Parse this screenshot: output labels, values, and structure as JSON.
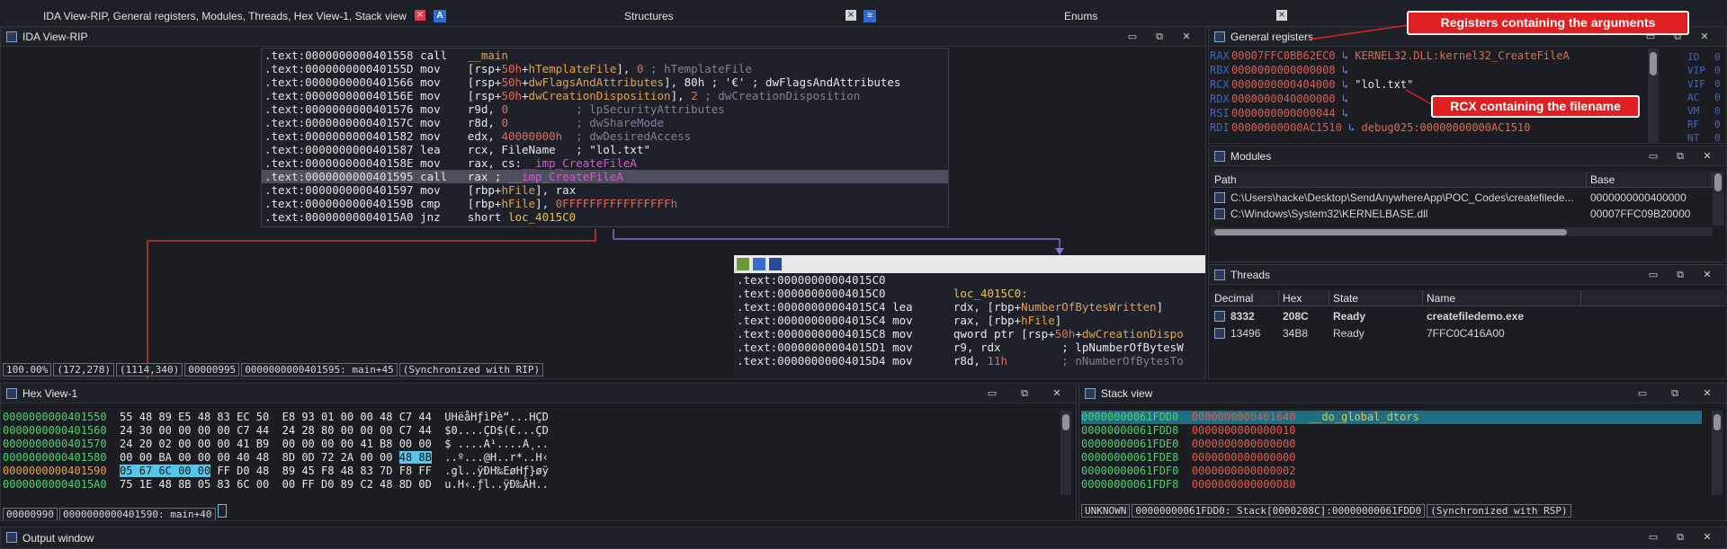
{
  "tabs": [
    {
      "label": "IDA View-RIP, General registers, Modules, Threads, Hex View-1, Stack view",
      "active": true
    },
    {
      "label": "Structures",
      "active": false
    },
    {
      "label": "Enums",
      "active": false
    }
  ],
  "ida_view": {
    "title": "IDA View-RIP",
    "main_block": [
      {
        "sec": ".text:",
        "addr": "0000000000401558",
        "mn": "call",
        "parts": [
          {
            "t": "__main",
            "c": "name"
          }
        ]
      },
      {
        "sec": ".text:",
        "addr": "000000000040155D",
        "mn": "mov",
        "parts": [
          {
            "t": "[rsp+",
            "c": "op"
          },
          {
            "t": "50h",
            "c": "imm"
          },
          {
            "t": "+",
            "c": "op"
          },
          {
            "t": "hTemplateFile",
            "c": "name"
          },
          {
            "t": "], ",
            "c": "op"
          },
          {
            "t": "0",
            "c": "imm"
          },
          {
            "t": " ; hTemplateFile",
            "c": "cm"
          }
        ]
      },
      {
        "sec": ".text:",
        "addr": "0000000000401566",
        "mn": "mov",
        "parts": [
          {
            "t": "[rsp+",
            "c": "op"
          },
          {
            "t": "50h",
            "c": "imm"
          },
          {
            "t": "+",
            "c": "op"
          },
          {
            "t": "dwFlagsAndAttributes",
            "c": "name"
          },
          {
            "t": "], 80h ; '€' ; dwFlagsAndAttributes",
            "c": "op2"
          }
        ]
      },
      {
        "sec": ".text:",
        "addr": "000000000040156E",
        "mn": "mov",
        "parts": [
          {
            "t": "[rsp+",
            "c": "op"
          },
          {
            "t": "50h",
            "c": "imm"
          },
          {
            "t": "+",
            "c": "op"
          },
          {
            "t": "dwCreationDisposition",
            "c": "name"
          },
          {
            "t": "], ",
            "c": "op"
          },
          {
            "t": "2",
            "c": "imm"
          },
          {
            "t": " ; dwCreationDisposition",
            "c": "cm"
          }
        ]
      },
      {
        "sec": ".text:",
        "addr": "0000000000401576",
        "mn": "mov",
        "parts": [
          {
            "t": "r9d, ",
            "c": "op"
          },
          {
            "t": "0",
            "c": "imm"
          },
          {
            "t": "          ; lpSecurityAttributes",
            "c": "cm"
          }
        ]
      },
      {
        "sec": ".text:",
        "addr": "000000000040157C",
        "mn": "mov",
        "parts": [
          {
            "t": "r8d, ",
            "c": "op"
          },
          {
            "t": "0",
            "c": "imm"
          },
          {
            "t": "          ; dwShareMode",
            "c": "cm"
          }
        ]
      },
      {
        "sec": ".text:",
        "addr": "0000000000401582",
        "mn": "mov",
        "parts": [
          {
            "t": "edx, ",
            "c": "op"
          },
          {
            "t": "40000000h",
            "c": "imm"
          },
          {
            "t": "  ; dwDesiredAccess",
            "c": "cm"
          }
        ]
      },
      {
        "sec": ".text:",
        "addr": "0000000000401587",
        "mn": "lea",
        "parts": [
          {
            "t": "rcx, FileName   ; \"lol.txt\"",
            "c": "op"
          }
        ]
      },
      {
        "sec": ".text:",
        "addr": "000000000040158E",
        "mn": "mov",
        "parts": [
          {
            "t": "rax, cs:",
            "c": "op"
          },
          {
            "t": "__imp_CreateFileA",
            "c": "imp"
          }
        ]
      },
      {
        "sec": ".text:",
        "addr": "0000000000401595",
        "mn": "call",
        "hl": true,
        "parts": [
          {
            "t": "rax ; ",
            "c": "op"
          },
          {
            "t": "__imp_CreateFileA",
            "c": "imp"
          }
        ]
      },
      {
        "sec": ".text:",
        "addr": "0000000000401597",
        "mn": "mov",
        "parts": [
          {
            "t": "[rbp+",
            "c": "op"
          },
          {
            "t": "hFile",
            "c": "name"
          },
          {
            "t": "], rax",
            "c": "op"
          }
        ]
      },
      {
        "sec": ".text:",
        "addr": "000000000040159B",
        "mn": "cmp",
        "parts": [
          {
            "t": "[rbp+",
            "c": "op"
          },
          {
            "t": "hFile",
            "c": "name"
          },
          {
            "t": "], ",
            "c": "op"
          },
          {
            "t": "0FFFFFFFFFFFFFFFFh",
            "c": "imm"
          }
        ]
      },
      {
        "sec": ".text:",
        "addr": "00000000004015A0",
        "mn": "jnz",
        "parts": [
          {
            "t": "short ",
            "c": "op"
          },
          {
            "t": "loc_4015C0",
            "c": "loc"
          }
        ]
      }
    ],
    "second_block": [
      {
        "sec": ".text:",
        "addr": "00000000004015C0",
        "mn": "",
        "parts": []
      },
      {
        "sec": ".text:",
        "addr": "00000000004015C0",
        "mn": "",
        "parts": [
          {
            "t": "loc_4015C0:",
            "c": "loc"
          }
        ]
      },
      {
        "sec": ".text:",
        "addr": "00000000004015C4",
        "mn": "lea",
        "parts": [
          {
            "t": "rdx, [rbp+",
            "c": "op"
          },
          {
            "t": "NumberOfBytesWritten",
            "c": "name"
          },
          {
            "t": "]",
            "c": "op"
          }
        ]
      },
      {
        "sec": ".text:",
        "addr": "00000000004015C4",
        "mn": "mov",
        "parts": [
          {
            "t": "rax, [rbp+",
            "c": "op"
          },
          {
            "t": "hFile",
            "c": "name"
          },
          {
            "t": "]",
            "c": "op"
          }
        ]
      },
      {
        "sec": ".text:",
        "addr": "00000000004015C8",
        "mn": "mov",
        "parts": [
          {
            "t": "qword ptr [rsp+",
            "c": "op"
          },
          {
            "t": "50h",
            "c": "imm"
          },
          {
            "t": "+",
            "c": "op"
          },
          {
            "t": "dwCreationDispo",
            "c": "name"
          }
        ]
      },
      {
        "sec": ".text:",
        "addr": "00000000004015D1",
        "mn": "mov",
        "parts": [
          {
            "t": "r9, rdx         ; lpNumberOfBytesW",
            "c": "op3"
          }
        ]
      },
      {
        "sec": ".text:",
        "addr": "00000000004015D4",
        "mn": "mov",
        "parts": [
          {
            "t": "r8d, ",
            "c": "op"
          },
          {
            "t": "11h",
            "c": "imm"
          },
          {
            "t": "        ; nNumberOfBytesTo",
            "c": "cm"
          }
        ]
      }
    ],
    "status": [
      "100.00%",
      "(172,278)",
      "(1114,340)",
      "00000995",
      "0000000000401595: main+45",
      "(Synchronized with RIP)"
    ]
  },
  "registers": {
    "title": "General registers",
    "rows": [
      {
        "name": "RAX",
        "value": "00007FFC0BB62EC0",
        "target": "KERNEL32.DLL:kernel32_CreateFileA"
      },
      {
        "name": "RBX",
        "value": "0000000000000008",
        "target": ""
      },
      {
        "name": "RCX",
        "value": "0000000000404000",
        "target": "\"lol.txt\""
      },
      {
        "name": "RDX",
        "value": "0000000040000000",
        "target": ""
      },
      {
        "name": "RSI",
        "value": "0000000000000044",
        "target": ""
      },
      {
        "name": "RDI",
        "value": "00000000000AC1510",
        "target": "debug025:00000000000AC1510"
      }
    ],
    "flags": [
      {
        "name": "ID",
        "value": "0"
      },
      {
        "name": "VIP",
        "value": "0"
      },
      {
        "name": "VIF",
        "value": "0"
      },
      {
        "name": "AC",
        "value": "0"
      },
      {
        "name": "VM",
        "value": "0"
      },
      {
        "name": "RF",
        "value": "0"
      },
      {
        "name": "NT",
        "value": "0"
      }
    ]
  },
  "annotations": {
    "registers_note": "Registers containing the arguments",
    "rcx_note": "RCX containing the filename"
  },
  "modules": {
    "title": "Modules",
    "columns": [
      "Path",
      "Base"
    ],
    "rows": [
      {
        "path": "C:\\Users\\hacke\\Desktop\\SendAnywhereApp\\POC_Codes\\createfilede...",
        "base": "0000000000400000"
      },
      {
        "path": "C:\\Windows\\System32\\KERNELBASE.dll",
        "base": "00007FFC09B20000"
      }
    ]
  },
  "threads": {
    "title": "Threads",
    "columns": [
      "Decimal",
      "Hex",
      "State",
      "Name"
    ],
    "rows": [
      {
        "decimal": "8332",
        "hex": "208C",
        "state": "Ready",
        "name": "createfiledemo.exe",
        "bold": true
      },
      {
        "decimal": "13496",
        "hex": "34B8",
        "state": "Ready",
        "name": "7FFC0C416A00",
        "bold": false
      }
    ]
  },
  "hex_view": {
    "title": "Hex View-1",
    "rows": [
      {
        "addr": "0000000000401550",
        "bytes": "55 48 89 E5 48 83 EC 50  E8 93 01 00 00 48 C7 44",
        "ascii": "UHëåHƒìPè“...HÇD"
      },
      {
        "addr": "0000000000401560",
        "bytes": "24 30 00 00 00 00 C7 44  24 28 80 00 00 00 C7 44",
        "ascii": "$0....ÇD$(€...ÇD"
      },
      {
        "addr": "0000000000401570",
        "bytes": "24 20 02 00 00 00 41 B9  00 00 00 00 41 B8 00 00",
        "ascii": "$ ....A¹....A¸.."
      },
      {
        "addr": "0000000000401580",
        "bytes_pre": "00 00 BA 00 00 00 40 48  8D 0D 72 2A 00 00 ",
        "bytes_sel": "48 8B",
        "ascii": "..º...@H..r*..H‹"
      },
      {
        "addr": "0000000000401590",
        "cur": true,
        "bytes_sel": "05 67 6C 00 00",
        "bytes_post": " FF D0 48  89 45 F8 48 83 7D F8 FF",
        "ascii": ".gl..ÿÐH‰EøHƒ}øÿ"
      },
      {
        "addr": "00000000004015A0",
        "bytes": "75 1E 48 8B 05 83 6C 00  00 FF D0 89 C2 48 8D 0D",
        "ascii": "u.H‹.ƒl..ÿÐ‰ÂH.."
      }
    ],
    "status": [
      "00000990",
      "0000000000401590: main+40"
    ]
  },
  "stack_view": {
    "title": "Stack view",
    "rows": [
      {
        "addr": "00000000061FDD0",
        "value": "0000000000401640",
        "ref": "__do_global_dtors",
        "hl": true
      },
      {
        "addr": "00000000061FDD8",
        "value": "0000000000000010",
        "ref": ""
      },
      {
        "addr": "00000000061FDE0",
        "value": "0000000000000000",
        "ref": ""
      },
      {
        "addr": "00000000061FDE8",
        "value": "0000000000000000",
        "ref": ""
      },
      {
        "addr": "00000000061FDF0",
        "value": "0000000000000002",
        "ref": ""
      },
      {
        "addr": "00000000061FDF8",
        "value": "0000000000000080",
        "ref": ""
      }
    ],
    "status": [
      "UNKNOWN",
      "00000000061FDD0: Stack[0000208C]:00000000061FDD0",
      "(Synchronized with RSP)"
    ]
  },
  "output_window": {
    "title": "Output window"
  },
  "colors": {
    "annotation_red": "#e02020",
    "highlight_row": "#4c4f5c",
    "hex_selection": "#58c6e8",
    "green_addr": "#48d26a",
    "red_value": "#e05a4c"
  }
}
